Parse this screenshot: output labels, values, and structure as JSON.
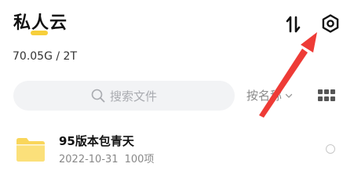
{
  "header": {
    "title": "私人云",
    "storage": "70.05G / 2T",
    "sort_icon": "sort-icon",
    "settings_icon": "settings-icon"
  },
  "search": {
    "placeholder": "搜索文件",
    "icon": "search-icon"
  },
  "toolbar": {
    "sort_label": "按名称",
    "sort_chevron_icon": "chevron-down-icon",
    "view_icon": "grid-view-icon"
  },
  "files": [
    {
      "name": "95版本包青天",
      "date": "2022-10-31",
      "count": "100项",
      "icon": "folder-icon"
    }
  ],
  "colors": {
    "accent": "#f7cf3b",
    "folder": "#f9d65a",
    "annotation_arrow": "#ee3b36"
  }
}
